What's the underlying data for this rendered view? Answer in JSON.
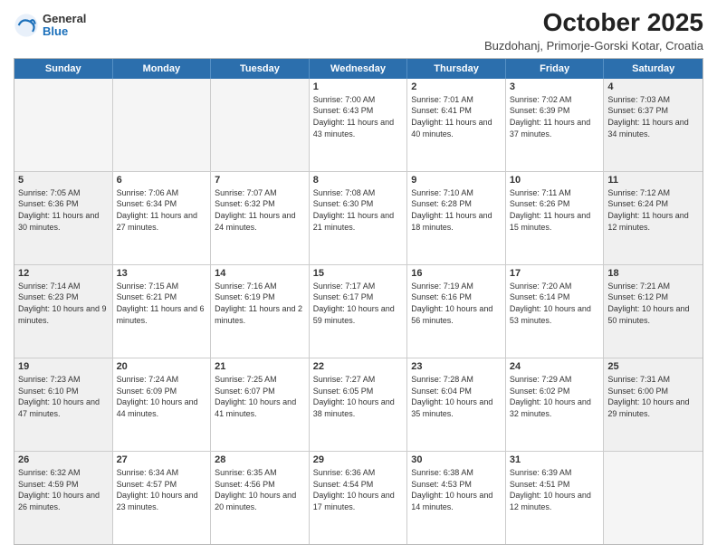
{
  "logo": {
    "general": "General",
    "blue": "Blue"
  },
  "title": "October 2025",
  "location": "Buzdohanj, Primorje-Gorski Kotar, Croatia",
  "days": [
    "Sunday",
    "Monday",
    "Tuesday",
    "Wednesday",
    "Thursday",
    "Friday",
    "Saturday"
  ],
  "weeks": [
    [
      {
        "day": "",
        "empty": true
      },
      {
        "day": "",
        "empty": true
      },
      {
        "day": "",
        "empty": true
      },
      {
        "day": "1",
        "sunrise": "7:00 AM",
        "sunset": "6:43 PM",
        "daylight": "11 hours and 43 minutes."
      },
      {
        "day": "2",
        "sunrise": "7:01 AM",
        "sunset": "6:41 PM",
        "daylight": "11 hours and 40 minutes."
      },
      {
        "day": "3",
        "sunrise": "7:02 AM",
        "sunset": "6:39 PM",
        "daylight": "11 hours and 37 minutes."
      },
      {
        "day": "4",
        "sunrise": "7:03 AM",
        "sunset": "6:37 PM",
        "daylight": "11 hours and 34 minutes."
      }
    ],
    [
      {
        "day": "5",
        "sunrise": "7:05 AM",
        "sunset": "6:36 PM",
        "daylight": "11 hours and 30 minutes."
      },
      {
        "day": "6",
        "sunrise": "7:06 AM",
        "sunset": "6:34 PM",
        "daylight": "11 hours and 27 minutes."
      },
      {
        "day": "7",
        "sunrise": "7:07 AM",
        "sunset": "6:32 PM",
        "daylight": "11 hours and 24 minutes."
      },
      {
        "day": "8",
        "sunrise": "7:08 AM",
        "sunset": "6:30 PM",
        "daylight": "11 hours and 21 minutes."
      },
      {
        "day": "9",
        "sunrise": "7:10 AM",
        "sunset": "6:28 PM",
        "daylight": "11 hours and 18 minutes."
      },
      {
        "day": "10",
        "sunrise": "7:11 AM",
        "sunset": "6:26 PM",
        "daylight": "11 hours and 15 minutes."
      },
      {
        "day": "11",
        "sunrise": "7:12 AM",
        "sunset": "6:24 PM",
        "daylight": "11 hours and 12 minutes."
      }
    ],
    [
      {
        "day": "12",
        "sunrise": "7:14 AM",
        "sunset": "6:23 PM",
        "daylight": "10 hours and 9 minutes."
      },
      {
        "day": "13",
        "sunrise": "7:15 AM",
        "sunset": "6:21 PM",
        "daylight": "11 hours and 6 minutes."
      },
      {
        "day": "14",
        "sunrise": "7:16 AM",
        "sunset": "6:19 PM",
        "daylight": "11 hours and 2 minutes."
      },
      {
        "day": "15",
        "sunrise": "7:17 AM",
        "sunset": "6:17 PM",
        "daylight": "10 hours and 59 minutes."
      },
      {
        "day": "16",
        "sunrise": "7:19 AM",
        "sunset": "6:16 PM",
        "daylight": "10 hours and 56 minutes."
      },
      {
        "day": "17",
        "sunrise": "7:20 AM",
        "sunset": "6:14 PM",
        "daylight": "10 hours and 53 minutes."
      },
      {
        "day": "18",
        "sunrise": "7:21 AM",
        "sunset": "6:12 PM",
        "daylight": "10 hours and 50 minutes."
      }
    ],
    [
      {
        "day": "19",
        "sunrise": "7:23 AM",
        "sunset": "6:10 PM",
        "daylight": "10 hours and 47 minutes."
      },
      {
        "day": "20",
        "sunrise": "7:24 AM",
        "sunset": "6:09 PM",
        "daylight": "10 hours and 44 minutes."
      },
      {
        "day": "21",
        "sunrise": "7:25 AM",
        "sunset": "6:07 PM",
        "daylight": "10 hours and 41 minutes."
      },
      {
        "day": "22",
        "sunrise": "7:27 AM",
        "sunset": "6:05 PM",
        "daylight": "10 hours and 38 minutes."
      },
      {
        "day": "23",
        "sunrise": "7:28 AM",
        "sunset": "6:04 PM",
        "daylight": "10 hours and 35 minutes."
      },
      {
        "day": "24",
        "sunrise": "7:29 AM",
        "sunset": "6:02 PM",
        "daylight": "10 hours and 32 minutes."
      },
      {
        "day": "25",
        "sunrise": "7:31 AM",
        "sunset": "6:00 PM",
        "daylight": "10 hours and 29 minutes."
      }
    ],
    [
      {
        "day": "26",
        "sunrise": "6:32 AM",
        "sunset": "4:59 PM",
        "daylight": "10 hours and 26 minutes."
      },
      {
        "day": "27",
        "sunrise": "6:34 AM",
        "sunset": "4:57 PM",
        "daylight": "10 hours and 23 minutes."
      },
      {
        "day": "28",
        "sunrise": "6:35 AM",
        "sunset": "4:56 PM",
        "daylight": "10 hours and 20 minutes."
      },
      {
        "day": "29",
        "sunrise": "6:36 AM",
        "sunset": "4:54 PM",
        "daylight": "10 hours and 17 minutes."
      },
      {
        "day": "30",
        "sunrise": "6:38 AM",
        "sunset": "4:53 PM",
        "daylight": "10 hours and 14 minutes."
      },
      {
        "day": "31",
        "sunrise": "6:39 AM",
        "sunset": "4:51 PM",
        "daylight": "10 hours and 12 minutes."
      },
      {
        "day": "",
        "empty": true
      }
    ]
  ]
}
